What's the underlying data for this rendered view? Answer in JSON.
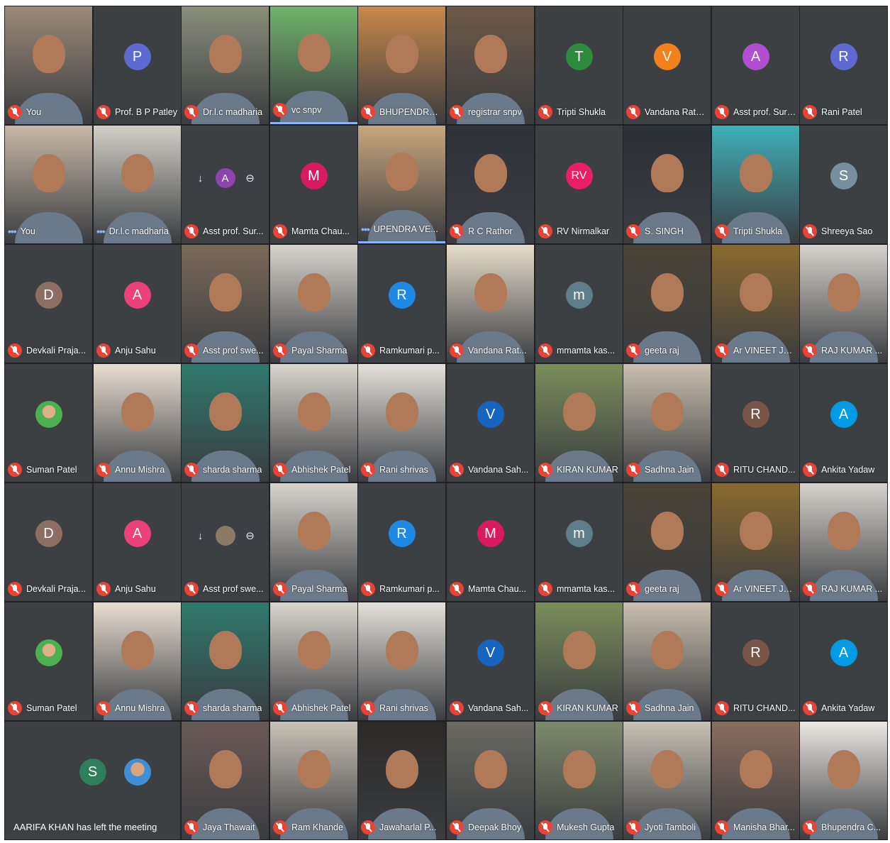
{
  "meeting": {
    "left_notification": "AARIFA KHAN has left the meeting",
    "rows": [
      [
        {
          "name": "You",
          "kind": "video",
          "tone": "#9a8a78"
        },
        {
          "name": "Prof. B P Patley",
          "kind": "avatar",
          "initial": "P",
          "color": "#5e6ad2"
        },
        {
          "name": "Dr.l.c madharia",
          "kind": "video",
          "tone": "#8a8e7a"
        },
        {
          "name": "vc snpv",
          "kind": "video",
          "tone": "#6fb36a",
          "speaking": true
        },
        {
          "name": "BHUPENDRA K...",
          "kind": "video",
          "tone": "#c9884a"
        },
        {
          "name": "registrar snpv",
          "kind": "video",
          "tone": "#6e5a48"
        },
        {
          "name": "Tripti Shukla",
          "kind": "avatar",
          "initial": "T",
          "color": "#2e8b3e"
        },
        {
          "name": "Vandana Rathore",
          "kind": "avatar",
          "initial": "V",
          "color": "#f2801d"
        },
        {
          "name": "Asst prof. Sure...",
          "kind": "avatar",
          "initial": "A",
          "color": "#b14fd0"
        },
        {
          "name": "Rani Patel",
          "kind": "avatar",
          "initial": "R",
          "color": "#5e6ad2"
        }
      ],
      [
        {
          "name": "You",
          "kind": "video",
          "tone": "#c7b9a6",
          "dots": true
        },
        {
          "name": "Dr.l.c madharia",
          "kind": "video",
          "tone": "#d2cfc6",
          "dots": true
        },
        {
          "name": "Asst prof. Sur...",
          "kind": "hover",
          "initial": "A",
          "color": "#8e44ad"
        },
        {
          "name": "Mamta Chau...",
          "kind": "avatar",
          "initial": "M",
          "color": "#d81b60"
        },
        {
          "name": "UPENDRA VE...",
          "kind": "video",
          "tone": "#c8a77e",
          "dots": true,
          "speaking": true
        },
        {
          "name": "R C Rathor",
          "kind": "video",
          "tone": "#30323a"
        },
        {
          "name": "RV Nirmalkar",
          "kind": "avatar",
          "initial": "RV",
          "color": "#e91e63"
        },
        {
          "name": "S. SINGH",
          "kind": "video",
          "tone": "#2c3136"
        },
        {
          "name": "Tripti Shukla",
          "kind": "video",
          "tone": "#3fb0b8"
        },
        {
          "name": "Shreeya Sao",
          "kind": "avatar",
          "initial": "S",
          "color": "#78909c"
        }
      ],
      [
        {
          "name": "Devkali Praja...",
          "kind": "avatar",
          "initial": "D",
          "color": "#8d6e63"
        },
        {
          "name": "Anju Sahu",
          "kind": "avatar",
          "initial": "A",
          "color": "#ec407a"
        },
        {
          "name": "Asst prof swe...",
          "kind": "video",
          "tone": "#7a6a58"
        },
        {
          "name": "Payal Sharma",
          "kind": "video",
          "tone": "#d8d4cc"
        },
        {
          "name": "Ramkumari p...",
          "kind": "avatar",
          "initial": "R",
          "color": "#1e88e5"
        },
        {
          "name": "Vandana Rat...",
          "kind": "video",
          "tone": "#e6dccb"
        },
        {
          "name": "mmamta kas...",
          "kind": "avatar",
          "initial": "m",
          "color": "#607d8b"
        },
        {
          "name": "geeta raj",
          "kind": "video",
          "tone": "#4a4436"
        },
        {
          "name": "Ar VINEET JA...",
          "kind": "video",
          "tone": "#8a6a2e"
        },
        {
          "name": "RAJ KUMAR ...",
          "kind": "video",
          "tone": "#d6d2cc"
        }
      ],
      [
        {
          "name": "Suman Patel",
          "kind": "video-small",
          "tone": "#4caf50"
        },
        {
          "name": "Annu Mishra",
          "kind": "video",
          "tone": "#e8ddd0"
        },
        {
          "name": "sharda sharma",
          "kind": "video",
          "tone": "#2f7a6e"
        },
        {
          "name": "Abhishek Patel",
          "kind": "video",
          "tone": "#d9d4cc"
        },
        {
          "name": "Rani shrivas",
          "kind": "video",
          "tone": "#e4e0da"
        },
        {
          "name": "Vandana Sah...",
          "kind": "avatar",
          "initial": "V",
          "color": "#1565c0"
        },
        {
          "name": "KIRAN KUMAR",
          "kind": "video",
          "tone": "#7a8e5a"
        },
        {
          "name": "Sadhna Jain",
          "kind": "video",
          "tone": "#c9bfae"
        },
        {
          "name": "RITU CHAND...",
          "kind": "avatar",
          "initial": "R",
          "color": "#795548"
        },
        {
          "name": "Ankita Yadaw",
          "kind": "avatar",
          "initial": "A",
          "color": "#039be5"
        }
      ],
      [
        {
          "name": "Devkali Praja...",
          "kind": "avatar",
          "initial": "D",
          "color": "#8d6e63"
        },
        {
          "name": "Anju Sahu",
          "kind": "avatar",
          "initial": "A",
          "color": "#ec407a"
        },
        {
          "name": "Asst prof swe...",
          "kind": "hover",
          "initial": "",
          "color": "#8a7a66"
        },
        {
          "name": "Payal Sharma",
          "kind": "video",
          "tone": "#d8d4cc"
        },
        {
          "name": "Ramkumari p...",
          "kind": "avatar",
          "initial": "R",
          "color": "#1e88e5"
        },
        {
          "name": "Mamta Chau...",
          "kind": "avatar",
          "initial": "M",
          "color": "#d81b60"
        },
        {
          "name": "mmamta kas...",
          "kind": "avatar",
          "initial": "m",
          "color": "#607d8b"
        },
        {
          "name": "geeta raj",
          "kind": "video",
          "tone": "#4a4436"
        },
        {
          "name": "Ar VINEET JA...",
          "kind": "video",
          "tone": "#8a6a2e"
        },
        {
          "name": "RAJ KUMAR ...",
          "kind": "video",
          "tone": "#d6d2cc"
        }
      ],
      [
        {
          "name": "Suman Patel",
          "kind": "video-small",
          "tone": "#4caf50"
        },
        {
          "name": "Annu Mishra",
          "kind": "video",
          "tone": "#e8ddd0"
        },
        {
          "name": "sharda sharma",
          "kind": "video",
          "tone": "#2f7a6e"
        },
        {
          "name": "Abhishek Patel",
          "kind": "video",
          "tone": "#d9d4cc"
        },
        {
          "name": "Rani shrivas",
          "kind": "video",
          "tone": "#e4e0da"
        },
        {
          "name": "Vandana Sah...",
          "kind": "avatar",
          "initial": "V",
          "color": "#1565c0"
        },
        {
          "name": "KIRAN KUMAR",
          "kind": "video",
          "tone": "#7a8e5a"
        },
        {
          "name": "Sadhna Jain",
          "kind": "video",
          "tone": "#c9bfae"
        },
        {
          "name": "RITU CHAND...",
          "kind": "avatar",
          "initial": "R",
          "color": "#795548"
        },
        {
          "name": "Ankita Yadaw",
          "kind": "avatar",
          "initial": "A",
          "color": "#039be5"
        }
      ],
      [
        {
          "name": "",
          "kind": "left",
          "initial": "S",
          "color": "#2e7d5b"
        },
        {
          "name": "",
          "kind": "left-photo",
          "tone": "#3f8ed8"
        },
        {
          "name": "Jaya Thawait",
          "kind": "video",
          "tone": "#6a5a58"
        },
        {
          "name": "Ram Khande",
          "kind": "video",
          "tone": "#c9c2b6"
        },
        {
          "name": "Jawaharlal P...",
          "kind": "video",
          "tone": "#2c2a28"
        },
        {
          "name": "Deepak Bhoy",
          "kind": "video",
          "tone": "#6a6a62"
        },
        {
          "name": "Mukesh Gupta",
          "kind": "video",
          "tone": "#7d8a6a"
        },
        {
          "name": "Jyoti Tamboli",
          "kind": "video",
          "tone": "#c8c2b4"
        },
        {
          "name": "Manisha Bhar...",
          "kind": "video",
          "tone": "#8a6e5e"
        },
        {
          "name": "Bhupendra C...",
          "kind": "video",
          "tone": "#ebe7e2"
        }
      ]
    ]
  }
}
